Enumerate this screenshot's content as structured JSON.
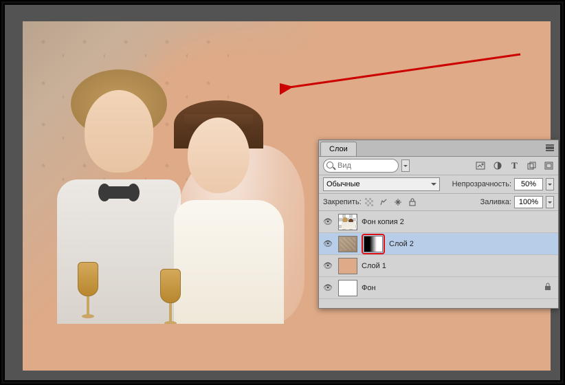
{
  "panel": {
    "tab": "Слои",
    "search_placeholder": "Вид",
    "blend_label": "Обычные",
    "opacity_label": "Непрозрачность:",
    "opacity_value": "50%",
    "lock_label": "Закрепить:",
    "fill_label": "Заливка:",
    "fill_value": "100%"
  },
  "layers": [
    {
      "name": "Фон копия 2"
    },
    {
      "name": "Слой 2"
    },
    {
      "name": "Слой 1"
    },
    {
      "name": "Фон"
    }
  ]
}
